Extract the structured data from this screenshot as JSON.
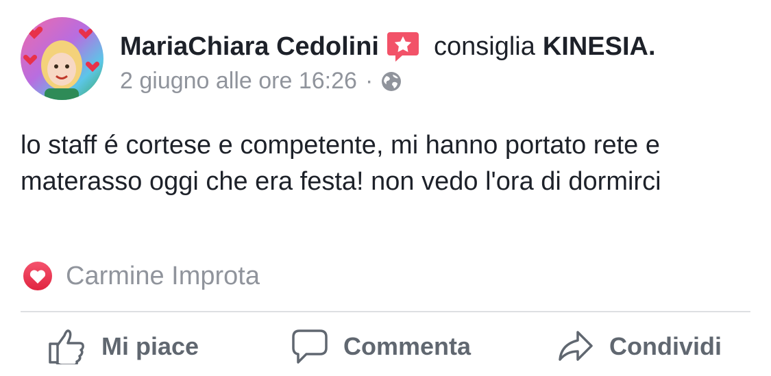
{
  "post": {
    "author": "MariaChiara Cedolini",
    "verb": "consiglia",
    "page_name": "KINESIA.",
    "timestamp": "2 giugno alle ore 16:26",
    "separator": "·",
    "privacy_icon": "globe-icon",
    "text": "lo staff é cortese e competente, mi hanno portato rete e materasso oggi che era festa! non vedo l'ora di dormirci"
  },
  "reactions": {
    "icon": "love-reaction-icon",
    "names": "Carmine Improta"
  },
  "actions": {
    "like_label": "Mi piace",
    "comment_label": "Commenta",
    "share_label": "Condividi"
  },
  "colors": {
    "text": "#1d2129",
    "meta": "#90949c",
    "action": "#606770",
    "love": "#f0284a",
    "badge": "#f25268",
    "divider": "#dddfe2"
  }
}
